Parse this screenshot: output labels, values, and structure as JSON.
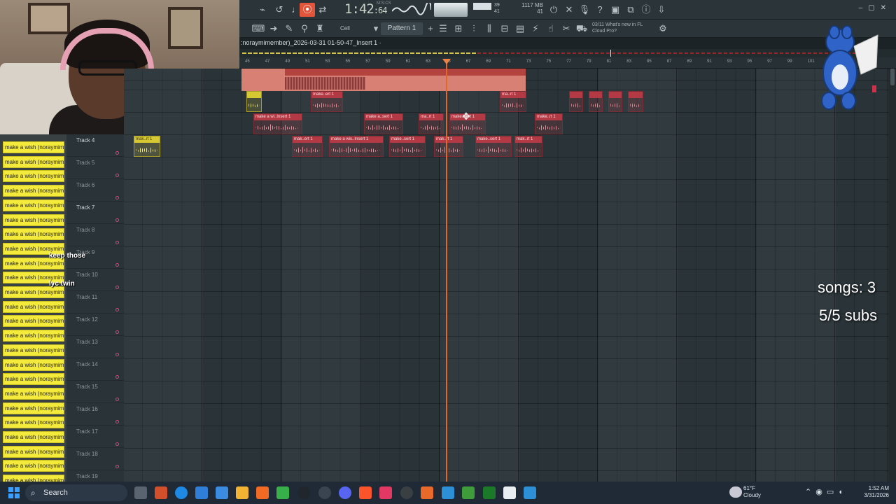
{
  "toolbar": {
    "time": "1:42",
    "time_fraction": ":64",
    "time_unit_label": "M:S:CS",
    "cpu_line1": "1117 MB",
    "cpu_line2": "41",
    "cpu_num1": "39",
    "cpu_num2": "41",
    "cell_label": "Cell",
    "pattern_label": "Pattern 1",
    "whatsnew_line1": "03/11  What's new in FL",
    "whatsnew_line2": "Cloud Pro?"
  },
  "playlist": {
    "title": ":noraymimember)_2026-03-31 01-50-47_Insert 1 ·",
    "ruler": [
      "45",
      "47",
      "49",
      "51",
      "53",
      "55",
      "57",
      "59",
      "61",
      "63",
      "65",
      "67",
      "69",
      "71",
      "73",
      "75",
      "77",
      "79",
      "81",
      "83",
      "85",
      "87",
      "89",
      "91",
      "93",
      "95",
      "97",
      "99",
      "101"
    ],
    "tracks": [
      {
        "name": "Track 4",
        "bold": true
      },
      {
        "name": "Track 5",
        "bold": false
      },
      {
        "name": "Track 6",
        "bold": false
      },
      {
        "name": "Track 7",
        "bold": true
      },
      {
        "name": "Track 8",
        "bold": false
      },
      {
        "name": "Track 9",
        "bold": false
      },
      {
        "name": "Track 10",
        "bold": false
      },
      {
        "name": "Track 11",
        "bold": false
      },
      {
        "name": "Track 12",
        "bold": false
      },
      {
        "name": "Track 13",
        "bold": false
      },
      {
        "name": "Track 14",
        "bold": false
      },
      {
        "name": "Track 15",
        "bold": false
      },
      {
        "name": "Track 16",
        "bold": false
      },
      {
        "name": "Track 17",
        "bold": false
      },
      {
        "name": "Track 18",
        "bold": false
      },
      {
        "name": "Track 19",
        "bold": false
      }
    ],
    "clips": [
      {
        "label": "",
        "row": 0,
        "color": "yellow"
      },
      {
        "label": "make..ert 1",
        "row": 0,
        "color": "red"
      },
      {
        "label": "ma..rt 1",
        "row": 0,
        "color": "red"
      },
      {
        "label": "",
        "row": 0,
        "color": "red"
      },
      {
        "label": "",
        "row": 0,
        "color": "red"
      },
      {
        "label": "",
        "row": 0,
        "color": "red"
      },
      {
        "label": "",
        "row": 0,
        "color": "red"
      },
      {
        "label": "make a wi..Insert 1",
        "row": 1,
        "color": "red"
      },
      {
        "label": "make a..sert 1",
        "row": 1,
        "color": "red"
      },
      {
        "label": "ma..rt 1",
        "row": 1,
        "color": "red"
      },
      {
        "label": "make..sert 1",
        "row": 1,
        "color": "red"
      },
      {
        "label": "make..rt 1",
        "row": 1,
        "color": "red"
      },
      {
        "label": "mak..ert 1",
        "row": 2,
        "color": "red"
      },
      {
        "label": "make a wis..Insert 1",
        "row": 2,
        "color": "red"
      },
      {
        "label": "make..sert 1",
        "row": 2,
        "color": "red"
      },
      {
        "label": "mak..rt 1",
        "row": 2,
        "color": "red"
      },
      {
        "label": "make..sert 1",
        "row": 2,
        "color": "red"
      },
      {
        "label": "mak..rt 1",
        "row": 2,
        "color": "red"
      },
      {
        "label": "mak..rt 1",
        "row": 3,
        "color": "yellow"
      }
    ]
  },
  "left_list": {
    "item_label": "make a wish (noraymimember)",
    "count": 24
  },
  "chat": {
    "lines": [
      {
        "user": "",
        "text": ""
      },
      {
        "user": "",
        "text": "keep those"
      },
      {
        "user": "",
        "text": ""
      },
      {
        "user": "",
        "text": "lyc twin"
      }
    ]
  },
  "overlay": {
    "songs": "songs: 3",
    "subs": "5/5 subs"
  },
  "taskbar": {
    "search": "Search",
    "weather_temp": "61°F",
    "weather_desc": "Cloudy",
    "time": "1:52 AM",
    "date": "3/31/2026"
  },
  "colors": {
    "playhead": "#e0672a",
    "clip_red": "#b33a45",
    "clip_yellow": "#d6c832",
    "list_yellow": "#f3ea3c"
  }
}
